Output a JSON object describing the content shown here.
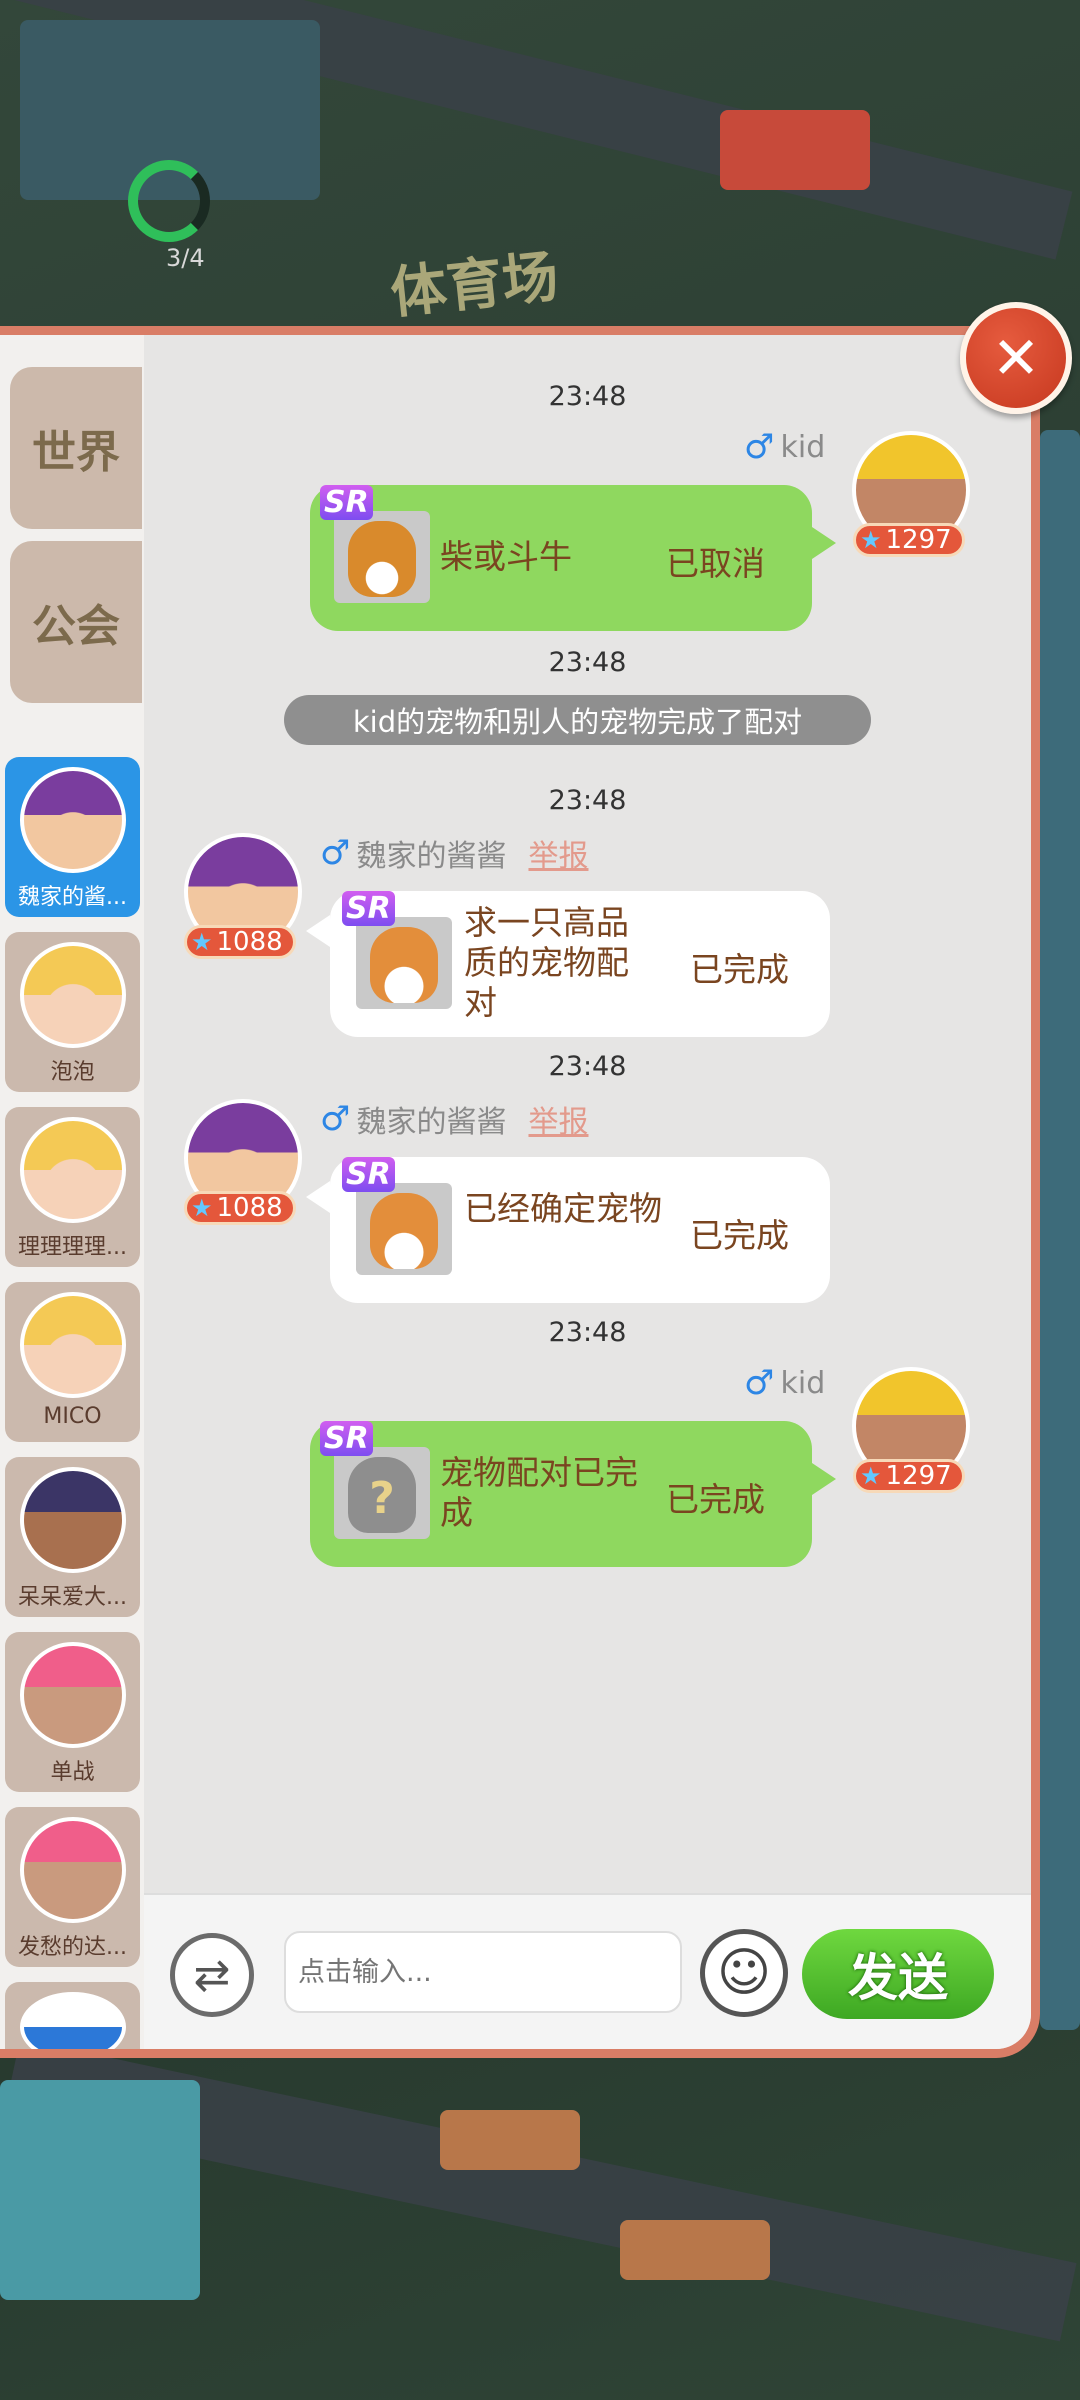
{
  "hud": {
    "counter": "3/4",
    "stadium_sign": "体育场"
  },
  "sidebar": {
    "tabs": [
      {
        "label": "世界"
      },
      {
        "label": "公会"
      }
    ],
    "contacts": [
      {
        "name": "魏家的酱...",
        "avatar": "purple-helmet-avatar",
        "active": true
      },
      {
        "name": "泡泡",
        "avatar": "blonde-girl-avatar"
      },
      {
        "name": "理理理理...",
        "avatar": "blonde-girl-avatar"
      },
      {
        "name": "MICO",
        "avatar": "blonde-girl-avatar"
      },
      {
        "name": "呆呆爱大...",
        "avatar": "police-avatar"
      },
      {
        "name": "单战",
        "avatar": "pink-cap-avatar"
      },
      {
        "name": "发愁的达...",
        "avatar": "pink-cap-avatar"
      }
    ]
  },
  "messages": {
    "m1": {
      "time": "23:48",
      "sender": "kid",
      "rarity": "SR",
      "text": "柴或斗牛",
      "status": "已取消",
      "level": "1297"
    },
    "sys": {
      "time": "23:48",
      "text": "kid的宠物和别人的宠物完成了配对"
    },
    "m2": {
      "time": "23:48",
      "sender": "魏家的酱酱",
      "report": "举报",
      "rarity": "SR",
      "text": "求一只高品质的宠物配对",
      "status": "已完成",
      "level": "1088"
    },
    "m3": {
      "time": "23:48",
      "sender": "魏家的酱酱",
      "report": "举报",
      "rarity": "SR",
      "text": "已经确定宠物",
      "status": "已完成",
      "level": "1088"
    },
    "m4": {
      "time": "23:48",
      "sender": "kid",
      "rarity": "SR",
      "text": "宠物配对已完成",
      "status": "已完成",
      "level": "1297"
    }
  },
  "input": {
    "placeholder": "点击输入...",
    "send_label": "发送"
  },
  "icons": {
    "gender": "♂",
    "close": "✕",
    "swap": "⇄",
    "emoji": "☺",
    "star": "★",
    "unknown_pet": "?"
  },
  "colors": {
    "panel_border": "#d97d66",
    "own_bubble": "#8fd85f",
    "active_contact": "#2b95e6",
    "send": "#4cbc2b"
  }
}
